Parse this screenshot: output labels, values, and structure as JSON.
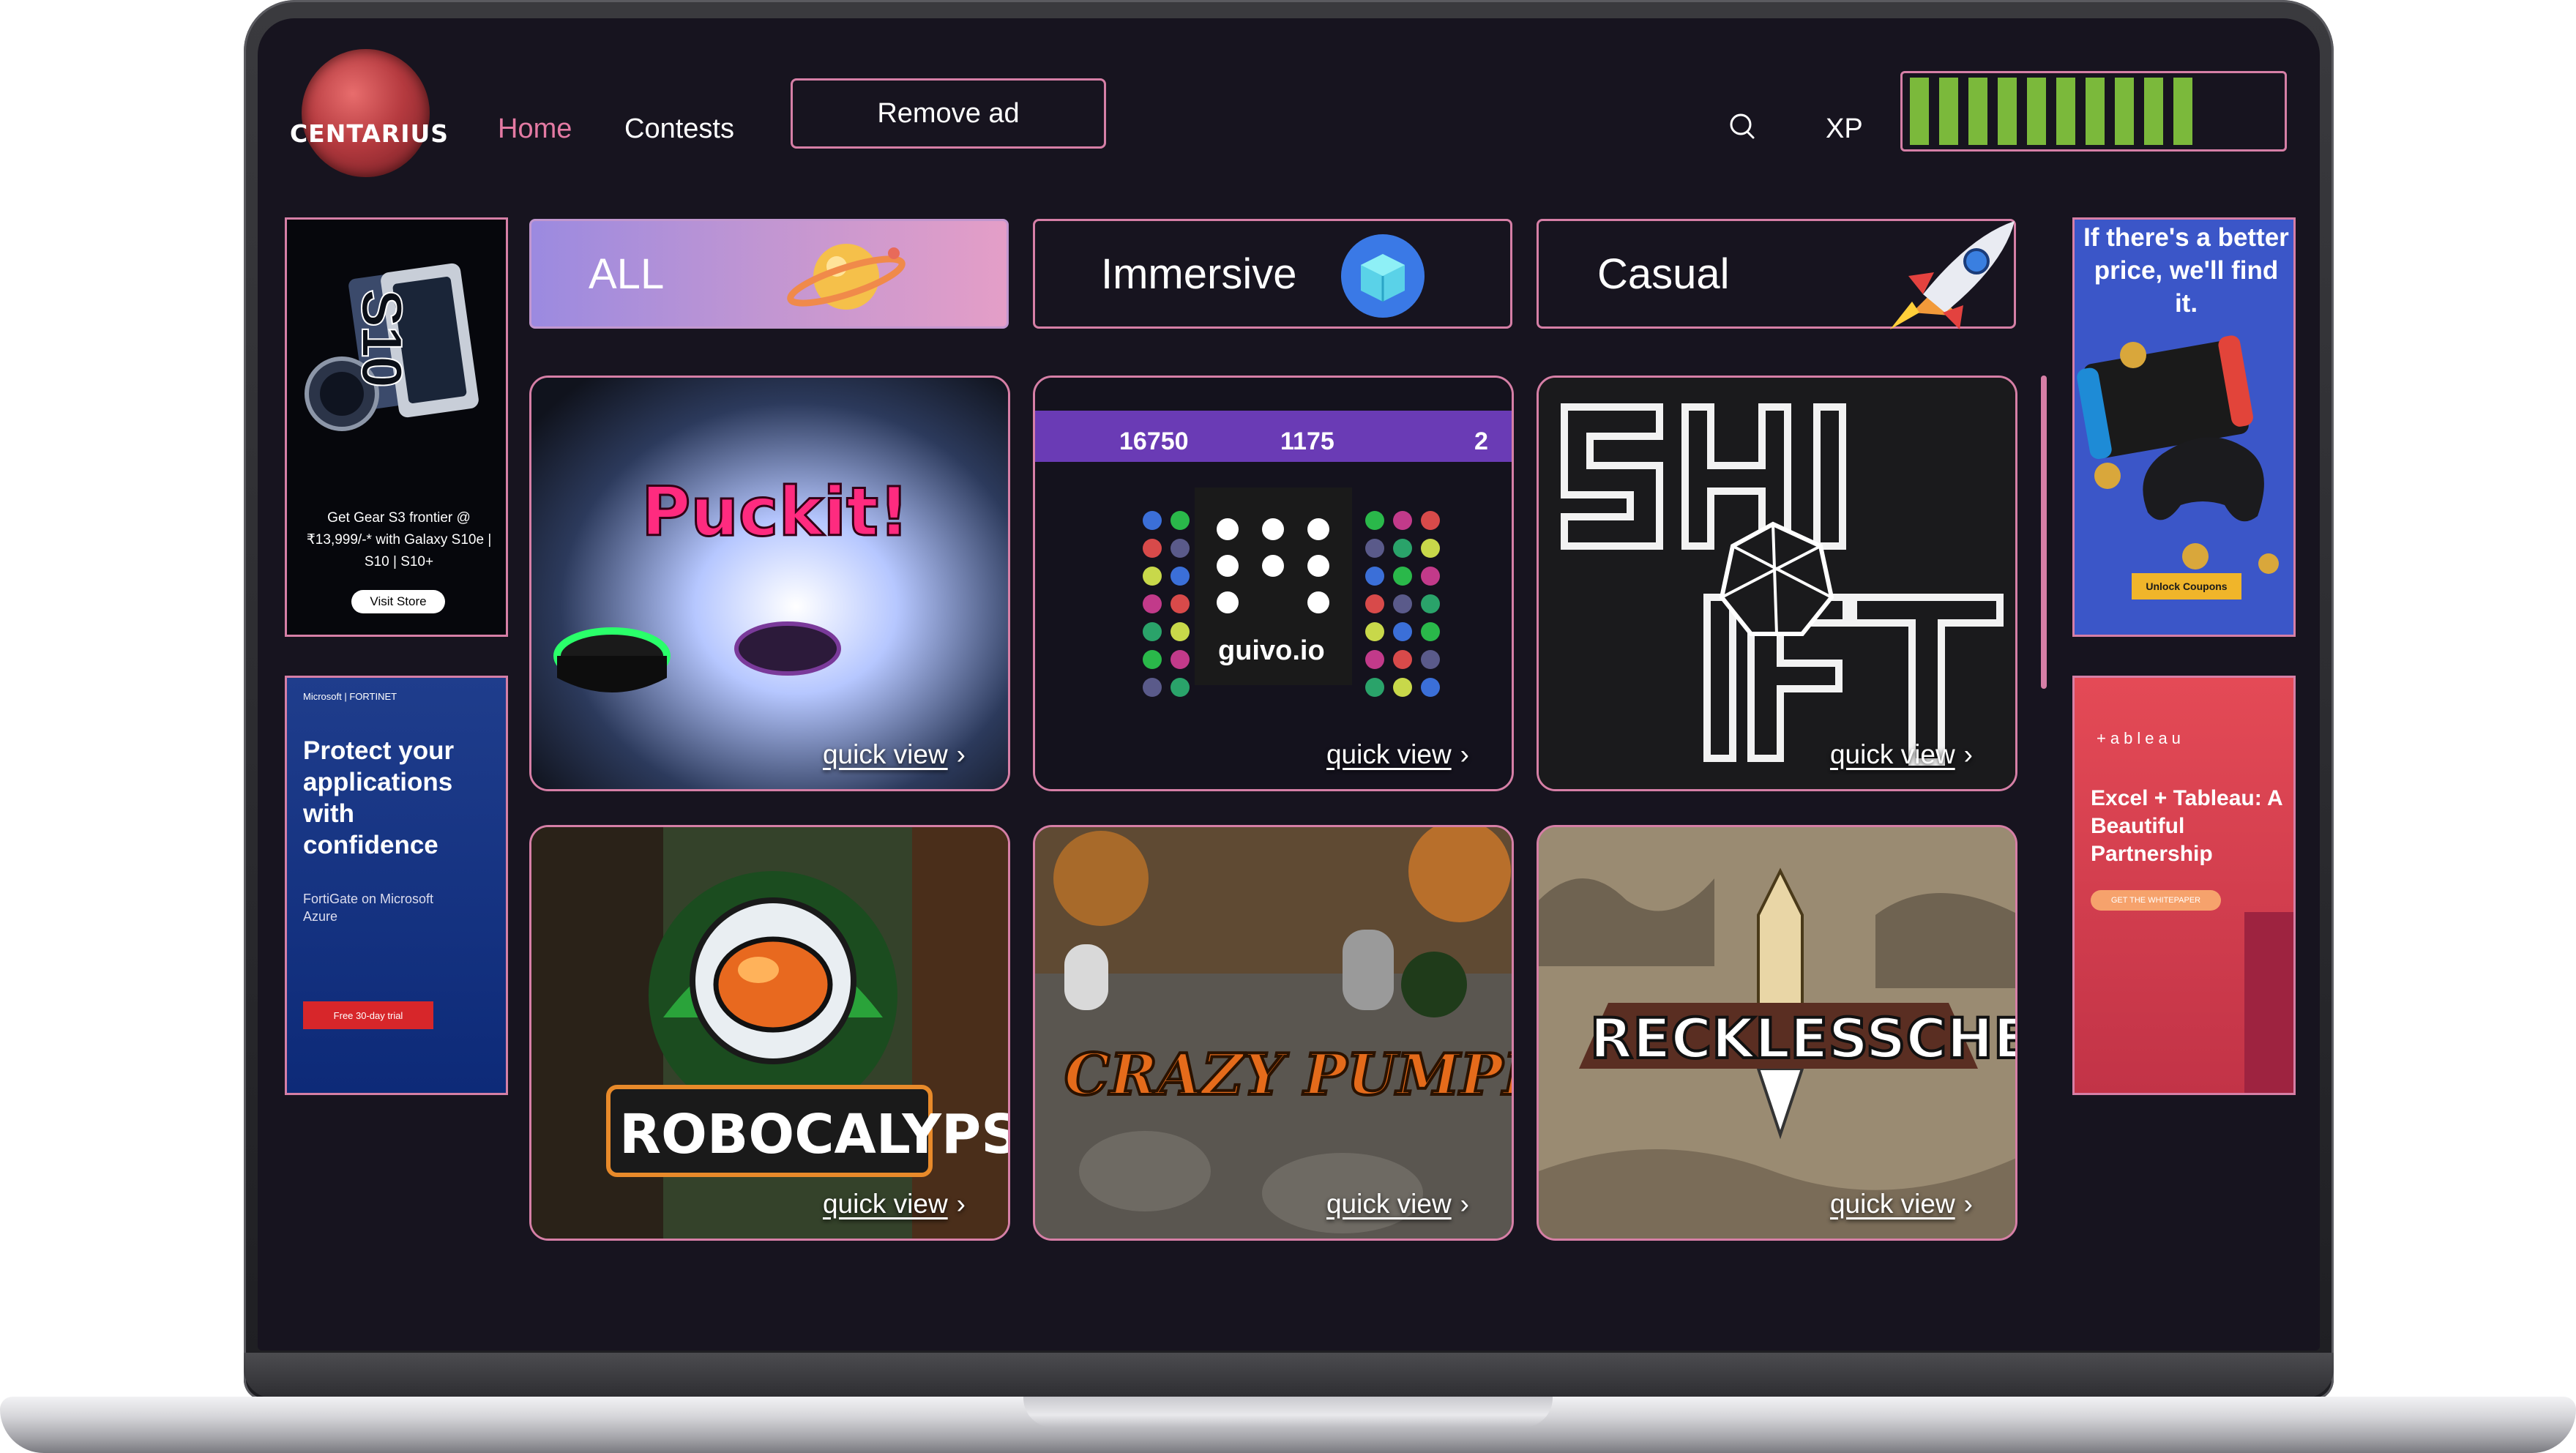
{
  "header": {
    "logo_text": "CENTARIUS",
    "nav": {
      "home": "Home",
      "contests": "Contests"
    },
    "remove_ad_label": "Remove ad",
    "xp_label": "XP",
    "xp_filled_segments": 10,
    "search_icon": "search-icon"
  },
  "categories": [
    {
      "label": "ALL",
      "icon": "planet-icon"
    },
    {
      "label": "Immersive",
      "icon": "cube-icon"
    },
    {
      "label": "Casual",
      "icon": "rocket-icon"
    }
  ],
  "games": [
    {
      "title": "Puckit!",
      "link": "quick view"
    },
    {
      "title": "guivo.io",
      "link": "quick view",
      "scores": [
        "16750",
        "1175",
        "2"
      ]
    },
    {
      "title": "SHIFT",
      "link": "quick view"
    },
    {
      "title": "ROBOCALYPSE",
      "link": "quick view"
    },
    {
      "title": "CRAZY PUMPKIN",
      "link": "quick view"
    },
    {
      "title": "RECKLESSCHESS",
      "link": "quick view"
    }
  ],
  "ads": {
    "left_top": {
      "text": "Get Gear S3 frontier @ ₹13,999/-* with Galaxy S10e | S10 | S10+",
      "button": "Visit Store",
      "model": "S10"
    },
    "left_bottom": {
      "brand": "Microsoft | FORTINET",
      "headline": "Protect your applications with confidence",
      "sub": "FortiGate on Microsoft Azure",
      "button": "Free 30-day trial"
    },
    "right_top": {
      "headline": "If there's a better price, we'll find it.",
      "button": "Unlock Coupons"
    },
    "right_bottom": {
      "brand": "+ableau",
      "headline": "Excel + Tableau: A Beautiful Partnership",
      "button": "GET THE WHITEPAPER"
    }
  },
  "colors": {
    "accent": "#d67fa6",
    "xp_green": "#7bb93b",
    "background": "#17141f",
    "home_active": "#e47aa3"
  }
}
